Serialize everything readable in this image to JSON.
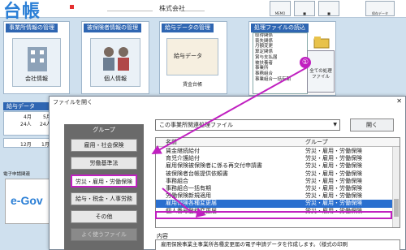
{
  "app": {
    "logo_text": "台帳",
    "company_prefix": "＿＿＿＿＿＿＿",
    "company_name": "株式会社＿＿＿"
  },
  "toolbar": [
    {
      "label": "MEMO"
    },
    {
      "label": "■"
    },
    {
      "label": "■"
    },
    {
      "label": "保存データ"
    }
  ],
  "sections": {
    "business": {
      "title": "事業所情報の管理",
      "card": "会社情報"
    },
    "insured": {
      "title": "被保険者情報の管理",
      "card": "個人情報"
    },
    "payroll": {
      "title": "給与データの管理",
      "card": "給与データ",
      "sub": "賃金台帳"
    },
    "processing": {
      "title": "処理ファイルの読込",
      "list": [
        "取得関係",
        "喪失関係",
        "月額変更",
        "算定関係",
        "賞与支払届",
        "被扶養者",
        "事業所",
        "事務組合",
        "事業組合一括有期"
      ],
      "files_button": "全ての処理ファイル"
    }
  },
  "payroll_mini": {
    "title": "給与データ",
    "cols": [
      "4月",
      "5月"
    ],
    "cells": [
      "24人",
      "24人"
    ],
    "row2": "12月",
    "row2b": "1月"
  },
  "egov": {
    "caption": "電子申請関連",
    "logo": "e-Gov"
  },
  "dialog": {
    "title": "ファイルを開く",
    "group_header": "グループ",
    "groups": [
      "雇用・社会保険",
      "労働基準法",
      "労災・雇用・労働保険",
      "給与・税金・人事労務",
      "その他",
      "よく使うファイル"
    ],
    "selected_group_index": 2,
    "combo_value": "この事業所関連処理ファイル",
    "open_button": "開く",
    "col_name": "名前",
    "col_group": "グループ",
    "rows": [
      {
        "name": "賃金継続給付",
        "group": "労災・雇用・労働保険"
      },
      {
        "name": "育児介護給付",
        "group": "労災・雇用・労働保険"
      },
      {
        "name": "雇用保険被保険者に係る再交付申請書",
        "group": "労災・雇用・労働保険"
      },
      {
        "name": "被保険者台帳提供依頼書",
        "group": "労災・雇用・労働保険"
      },
      {
        "name": "事務組合",
        "group": "労災・雇用・労働保険"
      },
      {
        "name": "事務組合一括有期",
        "group": "労災・雇用・労働保険"
      },
      {
        "name": "労働保険新規適用",
        "group": "労災・雇用・労働保険"
      },
      {
        "name": "雇用保険各種変更届",
        "group": "労災・雇用・労働保険"
      },
      {
        "name": "個人番号登録変更届",
        "group": "労災・雇用・労働保険"
      }
    ],
    "selected_row_index": 7,
    "desc_label": "内容",
    "desc_text": "雇用保険事業主事業所各種変更届の電子申請データを作成します。（様式の印刷"
  },
  "annotations": {
    "one": "①",
    "two": "②"
  },
  "colors": {
    "accent": "#2f66b2",
    "highlight": "#c020c0",
    "selection": "#2a6fcf"
  }
}
